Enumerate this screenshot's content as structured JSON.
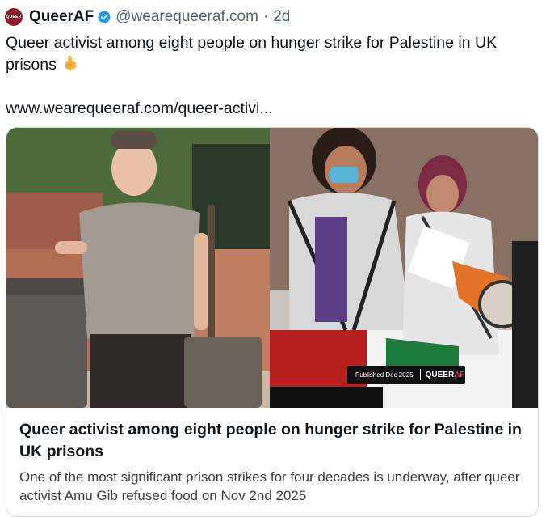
{
  "post": {
    "avatar_text": "QUEER",
    "display_name": "QueerAF",
    "handle": "@wearequeeraf.com",
    "separator": "·",
    "time": "2d",
    "text": "Queer activist among eight people on hunger strike for Palestine in UK prisons",
    "emoji_icon": "pointing-down-icon",
    "link_text": "www.wearequeeraf.com/queer-activi..."
  },
  "card": {
    "title": "Queer activist among eight people on hunger strike for Palestine in UK prisons",
    "description": "One of the most significant prison strikes for four decades is underway, after queer activist Amu Gib refused food on Nov 2nd 2025",
    "badge_published": "Published Dec 2025",
    "badge_logo_queer": "QUEER",
    "badge_logo_af": "AF"
  },
  "colors": {
    "verified": "#1d9bf0",
    "muted_text": "#536471",
    "avatar_bg": "#8b1e2d",
    "card_border": "#cfd9de",
    "logo_accent": "#e0304c"
  }
}
